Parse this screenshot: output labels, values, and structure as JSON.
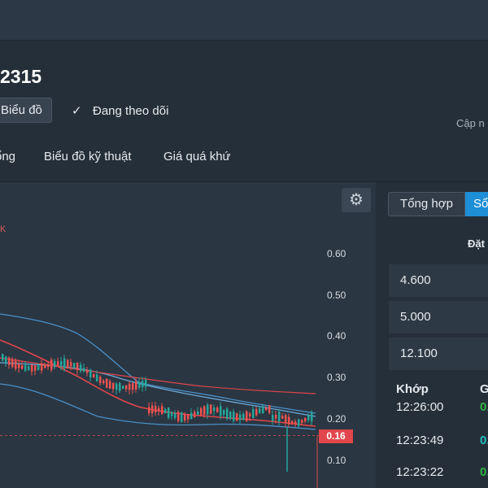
{
  "header": {
    "code": "2315",
    "chart_button": "Biểu đồ",
    "follow_label": "Đang theo dõi",
    "update_label": "Cập n"
  },
  "tabs": [
    {
      "label": "ổng"
    },
    {
      "label": "Biểu đồ kỹ thuật"
    },
    {
      "label": "Giá quá khứ"
    }
  ],
  "chart": {
    "legend_label": "K",
    "last_price": "0.16",
    "colors": {
      "up": "#26a69a",
      "down": "#ef5350",
      "ma": "#e0464b",
      "band": "#4a90c8"
    }
  },
  "chart_data": {
    "type": "candlestick",
    "y_ticks": [
      "0.60",
      "0.50",
      "0.40",
      "0.30",
      "0.20",
      "0.10"
    ],
    "ylim": [
      0.0,
      0.62
    ],
    "last_price": 0.16
  },
  "orderbook": {
    "tab_summary": "Tổng hợp",
    "tab_book": "Sổ",
    "column_header": "Đặt",
    "rows": [
      "4.600",
      "5.000",
      "12.100"
    ],
    "trades_header": "Khớp",
    "trades_header2": "G",
    "trades": [
      {
        "time": "12:26:00",
        "mark": "0.",
        "color": "#2fb344"
      },
      {
        "time": "12:23:49",
        "mark": "0.",
        "color": "#20c0c0"
      },
      {
        "time": "12:23:22",
        "mark": "0.",
        "color": "#2fb344"
      }
    ]
  }
}
